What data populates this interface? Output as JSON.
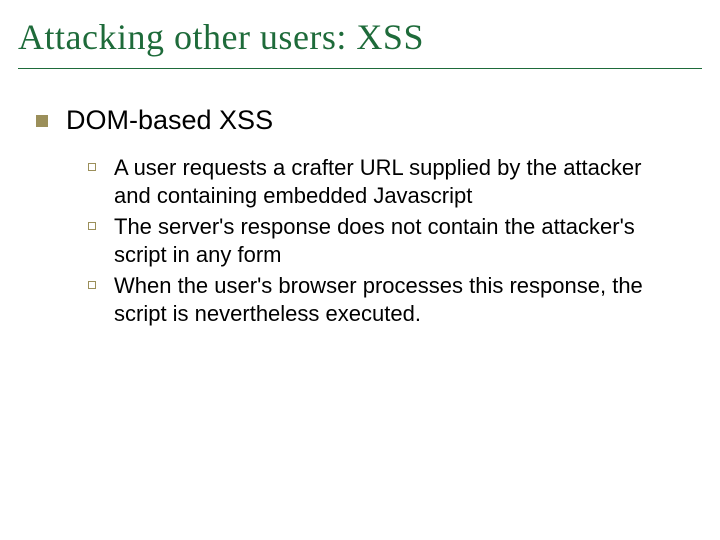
{
  "title": "Attacking other users: XSS",
  "level1": {
    "text": "DOM-based XSS"
  },
  "level2": [
    {
      "text": "A user requests a crafter URL supplied by the attacker and containing embedded Javascript"
    },
    {
      "text": "The server's response does not contain the attacker's script in any form"
    },
    {
      "text": "When the user's browser processes this response, the script is nevertheless executed."
    }
  ]
}
